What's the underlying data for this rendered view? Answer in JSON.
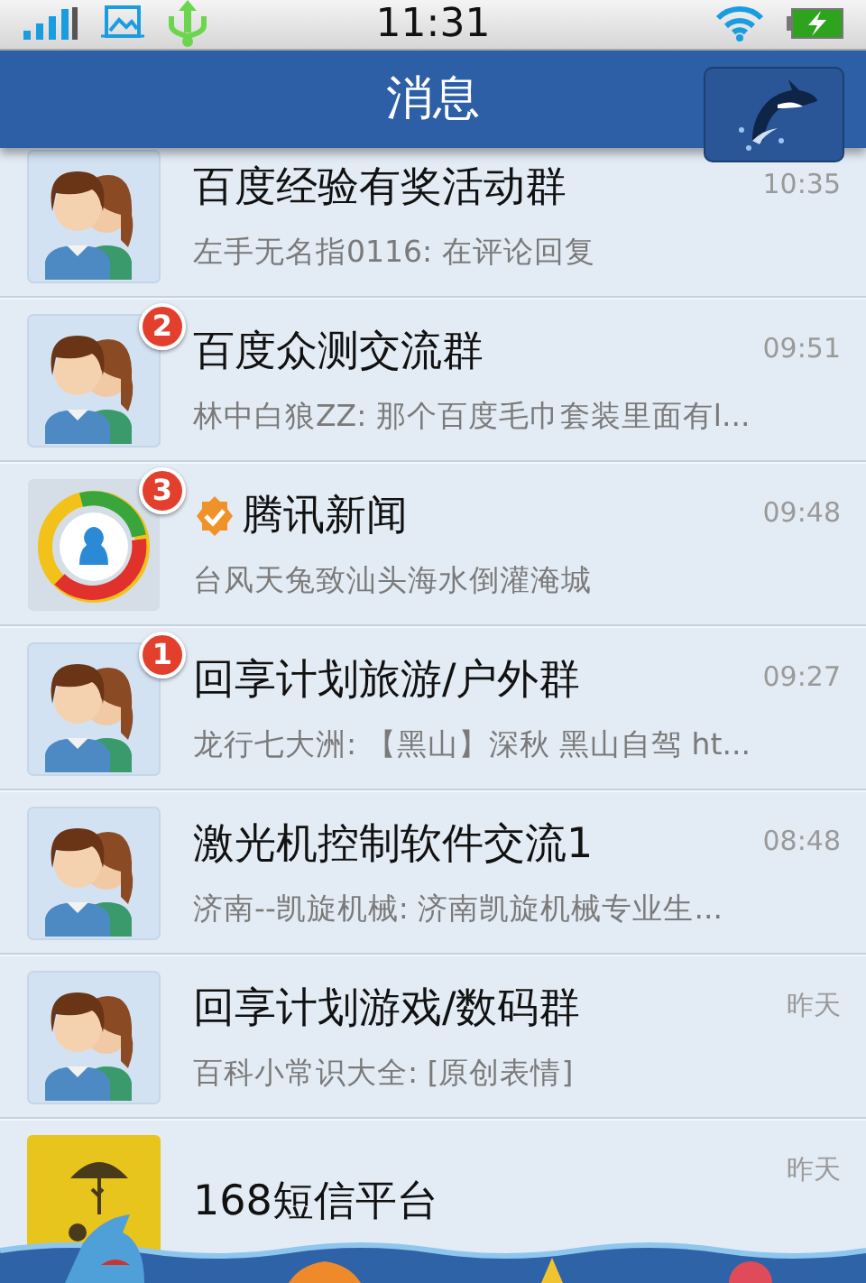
{
  "status_bar": {
    "time": "11:31"
  },
  "header": {
    "title": "消息"
  },
  "conversations": [
    {
      "kind": "group",
      "name": "百度经验有奖活动群",
      "verified": false,
      "preview": "左手无名指0116: 在评论回复",
      "time": "10:35"
    },
    {
      "kind": "group",
      "badge": "2",
      "name": "百度众测交流群",
      "verified": false,
      "preview": "林中白狼ZZ: 那个百度毛巾套装里面有l...",
      "time": "09:51"
    },
    {
      "kind": "news",
      "badge": "3",
      "name": "腾讯新闻",
      "verified": true,
      "preview": "台风天兔致汕头海水倒灌淹城",
      "time": "09:48"
    },
    {
      "kind": "group",
      "badge": "1",
      "name": "回享计划旅游/户外群",
      "verified": false,
      "preview": "龙行七大洲: 【黑山】深秋 黑山自驾 ht...",
      "time": "09:27"
    },
    {
      "kind": "group",
      "name": "激光机控制软件交流1",
      "verified": false,
      "preview": "济南--凯旋机械: 济南凯旋机械专业生...",
      "time": "08:48"
    },
    {
      "kind": "group",
      "name": "回享计划游戏/数码群",
      "verified": false,
      "preview": "百科小常识大全: [原创表情]",
      "time": "昨天"
    },
    {
      "kind": "umbrella",
      "name": "168短信平台",
      "verified": false,
      "time": "昨天"
    }
  ]
}
